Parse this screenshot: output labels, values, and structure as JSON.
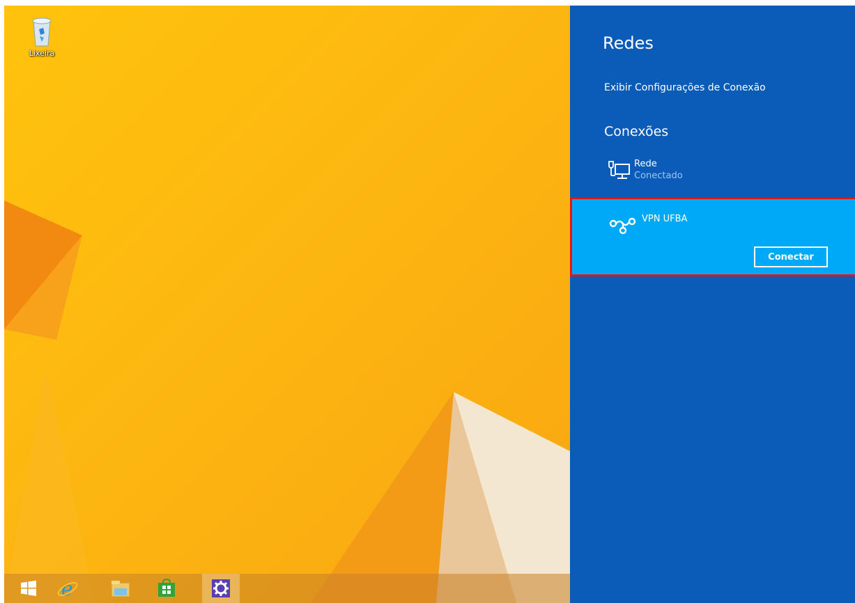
{
  "desktop": {
    "recycle_bin_label": "Lixeira",
    "recycle_bin_icon": "recycle-bin-icon"
  },
  "taskbar": {
    "items": [
      {
        "icon": "windows-start-icon"
      },
      {
        "icon": "internet-explorer-icon"
      },
      {
        "icon": "file-explorer-icon"
      },
      {
        "icon": "windows-store-icon"
      },
      {
        "icon": "settings-gear-icon",
        "active": true
      }
    ]
  },
  "networks_pane": {
    "title": "Redes",
    "view_settings_link": "Exibir Configurações de Conexão",
    "connections_heading": "Conexões",
    "connections": [
      {
        "name": "Rede",
        "status": "Conectado",
        "icon": "wired-network-icon"
      },
      {
        "name": "VPN UFBA",
        "icon": "vpn-icon",
        "action_label": "Conectar",
        "selected": true
      }
    ]
  },
  "colors": {
    "pane_background": "#0a5cb8",
    "selected_item": "#00a9f6",
    "highlight_frame": "#ee1111",
    "wallpaper": "#fdb711"
  }
}
